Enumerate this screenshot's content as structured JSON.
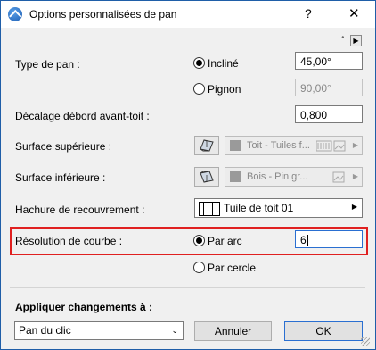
{
  "window": {
    "title": "Options personnalisées de pan",
    "help": "?",
    "close": "✕",
    "top_tools": "°",
    "top_arrow": "▶"
  },
  "type_de_pan": {
    "label": "Type de pan :",
    "incline_label": "Incliné",
    "incline_value": "45,00°",
    "pignon_label": "Pignon",
    "pignon_value": "90,00°"
  },
  "decalage": {
    "label": "Décalage débord avant-toit :",
    "value": "0,800"
  },
  "surface_superieure": {
    "label": "Surface supérieure :",
    "material": "Toit - Tuiles f...",
    "arrow": "▶"
  },
  "surface_inferieure": {
    "label": "Surface inférieure :",
    "material": "Bois - Pin gr...",
    "arrow": "▶"
  },
  "hachure": {
    "label": "Hachure de recouvrement :",
    "value": "Tuile de toit 01",
    "arrow": "▶"
  },
  "resolution": {
    "label": "Résolution de courbe :",
    "par_arc_label": "Par arc",
    "par_arc_value": "6",
    "par_cercle_label": "Par cercle"
  },
  "appliquer": {
    "label": "Appliquer changements à :",
    "selected": "Pan du clic",
    "chevron": "⌄"
  },
  "buttons": {
    "cancel": "Annuler",
    "ok": "OK"
  }
}
